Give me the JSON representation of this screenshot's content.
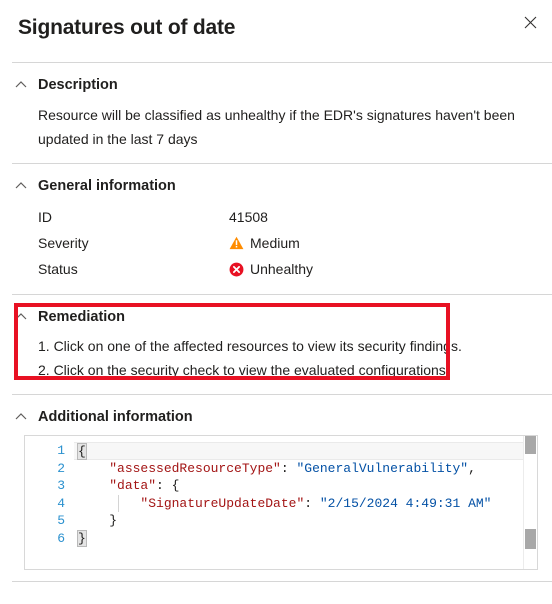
{
  "header": {
    "title": "Signatures out of date",
    "close_label": "Close"
  },
  "sections": {
    "description": {
      "title": "Description",
      "text": "Resource will be classified as unhealthy if the EDR's signatures haven't been updated in the last 7 days"
    },
    "general_information": {
      "title": "General information",
      "rows": [
        {
          "key": "ID",
          "value": "41508",
          "icon": ""
        },
        {
          "key": "Severity",
          "value": "Medium",
          "icon": "warning-triangle-icon"
        },
        {
          "key": "Status",
          "value": "Unhealthy",
          "icon": "error-circle-icon"
        }
      ]
    },
    "remediation": {
      "title": "Remediation",
      "steps": [
        "1. Click on one of the affected resources to view its security findings.",
        "2. Click on the security check to view the evaluated configurations."
      ]
    },
    "additional_information": {
      "title": "Additional information",
      "code": {
        "line_numbers": [
          "1",
          "2",
          "3",
          "4",
          "5",
          "6"
        ],
        "lines": [
          {
            "n": "1",
            "tokens": [
              {
                "t": "{",
                "c": "punc"
              }
            ]
          },
          {
            "n": "2",
            "tokens": [
              {
                "t": "    ",
                "c": "punc"
              },
              {
                "t": "\"assessedResourceType\"",
                "c": "key"
              },
              {
                "t": ": ",
                "c": "punc"
              },
              {
                "t": "\"GeneralVulnerability\"",
                "c": "str"
              },
              {
                "t": ",",
                "c": "punc"
              }
            ]
          },
          {
            "n": "3",
            "tokens": [
              {
                "t": "    ",
                "c": "punc"
              },
              {
                "t": "\"data\"",
                "c": "key"
              },
              {
                "t": ": {",
                "c": "punc"
              }
            ]
          },
          {
            "n": "4",
            "tokens": [
              {
                "t": "        ",
                "c": "punc"
              },
              {
                "t": "\"SignatureUpdateDate\"",
                "c": "key"
              },
              {
                "t": ": ",
                "c": "punc"
              },
              {
                "t": "\"2/15/2024 4:49:31 AM\"",
                "c": "str"
              }
            ]
          },
          {
            "n": "5",
            "tokens": [
              {
                "t": "    }",
                "c": "punc"
              }
            ]
          },
          {
            "n": "6",
            "tokens": [
              {
                "t": "}",
                "c": "punc"
              }
            ]
          }
        ]
      }
    }
  },
  "colors": {
    "severity_icon": "#ff8c00",
    "status_icon": "#e81123",
    "highlight_box": "#e81123",
    "json_key": "#a31515",
    "json_string": "#0451a5",
    "line_number": "#2b91cf"
  }
}
